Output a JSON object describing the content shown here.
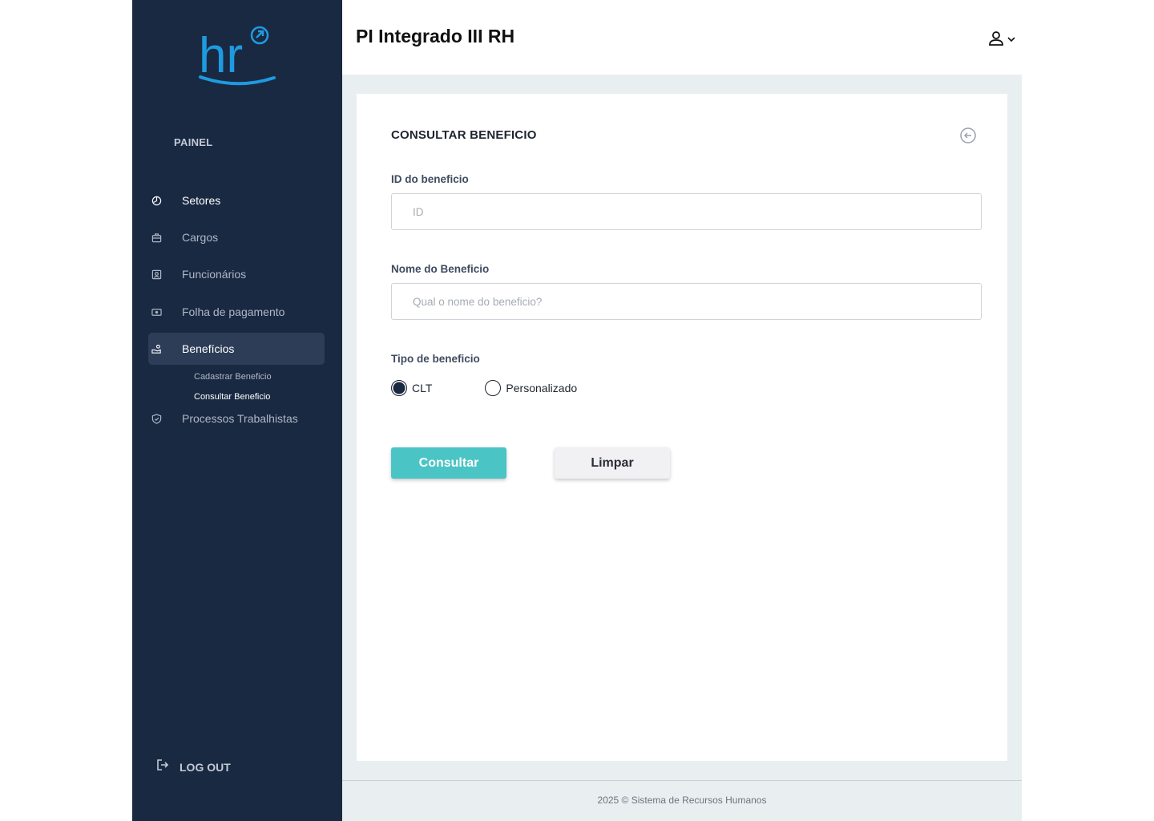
{
  "app": {
    "title": "PI Integrado III RH",
    "logo_text": "hr"
  },
  "colors": {
    "sidebar_bg": "#1a2942",
    "sidebar_active": "#2d3d57",
    "logo_blue": "#1e9be0",
    "primary_button": "#4bc4c6",
    "main_bg": "#e9eff0"
  },
  "sidebar": {
    "section_label": "PAINEL",
    "items": [
      {
        "label": "Setores",
        "icon": "pie-chart-icon"
      },
      {
        "label": "Cargos",
        "icon": "briefcase-icon"
      },
      {
        "label": "Funcionários",
        "icon": "id-badge-icon"
      },
      {
        "label": "Folha de pagamento",
        "icon": "money-icon"
      },
      {
        "label": "Benefícios",
        "icon": "hand-coins-icon",
        "active": true
      },
      {
        "label": "Processos Trabalhistas",
        "icon": "shield-icon"
      }
    ],
    "sub_items": [
      {
        "label": "Cadastrar Beneficio"
      },
      {
        "label": "Consultar Beneficio",
        "current": true
      }
    ],
    "logout_label": "LOG OUT"
  },
  "header": {
    "user_icon": "user-icon"
  },
  "form": {
    "title": "CONSULTAR BENEFICIO",
    "id_label": "ID do beneficio",
    "id_placeholder": "ID",
    "id_value": "",
    "name_label": "Nome do Beneficio",
    "name_placeholder": "Qual o nome do beneficio?",
    "name_value": "",
    "type_label": "Tipo de beneficio",
    "type_options": [
      {
        "label": "CLT",
        "selected": true
      },
      {
        "label": "Personalizado",
        "selected": false
      }
    ],
    "submit_label": "Consultar",
    "clear_label": "Limpar"
  },
  "footer": {
    "text": "2025 © Sistema de Recursos Humanos"
  }
}
